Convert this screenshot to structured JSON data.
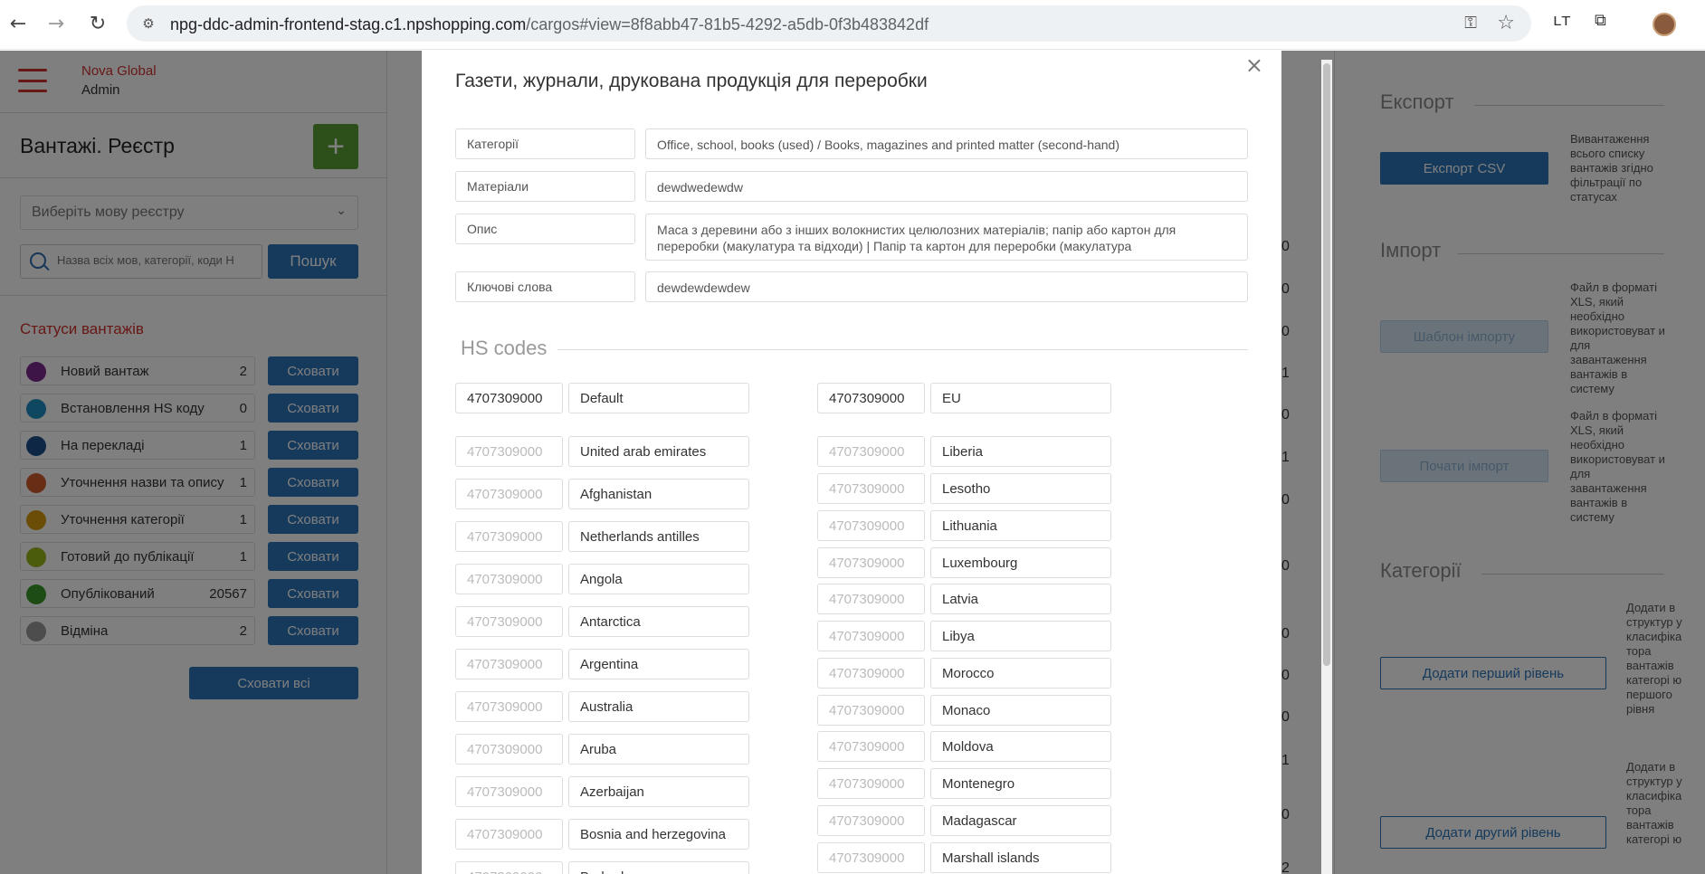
{
  "browser": {
    "url_host": "npg-ddc-admin-frontend-stag.c1.npshopping.com",
    "url_path": "/cargos#view=8f8abb47-81b5-4292-a5db-0f3b483842df"
  },
  "sidebar": {
    "brand_line1": "Nova Global",
    "brand_line2": "Admin",
    "title": "Вантажі. Реєстр",
    "add_label": "+",
    "lang_placeholder": "Виберіть мову реєстру",
    "search_placeholder": "Назва всіх мов, категорії, коди Н",
    "search_button": "Пошук",
    "statuses_title": "Статуси вантажів",
    "hide_label": "Сховати",
    "hide_all_label": "Сховати всі",
    "statuses": [
      {
        "label": "Новий вантаж",
        "count": "2",
        "color": "#7b2a8e"
      },
      {
        "label": "Встановлення HS коду",
        "count": "0",
        "color": "#1f8fc2"
      },
      {
        "label": "На перекладі",
        "count": "1",
        "color": "#1a4f8a"
      },
      {
        "label": "Уточнення назви та опису",
        "count": "1",
        "color": "#d05a2a"
      },
      {
        "label": "Уточнення категорії",
        "count": "1",
        "color": "#d99a10"
      },
      {
        "label": "Готовий до публікації",
        "count": "1",
        "color": "#98b81a"
      },
      {
        "label": "Опублікований",
        "count": "20567",
        "color": "#3a9a2a"
      },
      {
        "label": "Відміна",
        "count": "2",
        "color": "#9a9a9a"
      }
    ]
  },
  "right_panel": {
    "export_title": "Експорт",
    "export_button": "Експорт CSV",
    "export_note": "Вивантаження всього списку вантажів згідно фільтрації по статусах",
    "import_title": "Імпорт",
    "import_template_button": "Шаблон імпорту",
    "import_template_note": "Файл в форматі XLS, який необхідно використовуват и для завантаження вантажів в систему",
    "import_start_button": "Почати імпорт",
    "import_start_note": "Файл в форматі XLS, який необхідно використовуват и для завантаження вантажів в систему",
    "categories_title": "Категорії",
    "add_first_level": "Додати перший рівень",
    "add_first_note": "Додати в структур у класифіка тора вантажів категорі ю першого рівня",
    "add_second_level": "Додати другий рівень",
    "add_second_note": "Додати в структур у класифіка тора вантажів категорі ю"
  },
  "background_numbers": [
    "0",
    "0",
    "0",
    "1",
    "0",
    "1",
    "0",
    "0",
    "0",
    "0",
    "0",
    "1",
    "0",
    "2"
  ],
  "modal": {
    "close_label": "×",
    "title": "Газети, журнали, друкована продукція для переробки",
    "fields": [
      {
        "label": "Категорії",
        "value": "Office, school, books (used) / Books, magazines and printed matter (second-hand)"
      },
      {
        "label": "Матеріали",
        "value": "dewdwedewdw"
      },
      {
        "label": "Опис",
        "value": "Маса з деревини або з інших волокнистих целюлозних матеріалів; папір або картон для переробки (макулатура та відходи) | Папір та картон для переробки (макулатура"
      },
      {
        "label": "Ключові слова",
        "value": "dewdewdewdew"
      }
    ],
    "hs_title": "HS codes",
    "default_code": {
      "code": "4707309000",
      "country": "Default"
    },
    "eu_code": {
      "code": "4707309000",
      "country": "EU"
    },
    "code_placeholder": "4707309000",
    "left_countries": [
      "United arab emirates",
      "Afghanistan",
      "Netherlands antilles",
      "Angola",
      "Antarctica",
      "Argentina",
      "Australia",
      "Aruba",
      "Azerbaijan",
      "Bosnia and herzegovina",
      "Barbados"
    ],
    "right_countries": [
      "Liberia",
      "Lesotho",
      "Lithuania",
      "Luxembourg",
      "Latvia",
      "Libya",
      "Morocco",
      "Monaco",
      "Moldova",
      "Montenegro",
      "Madagascar",
      "Marshall islands"
    ]
  }
}
